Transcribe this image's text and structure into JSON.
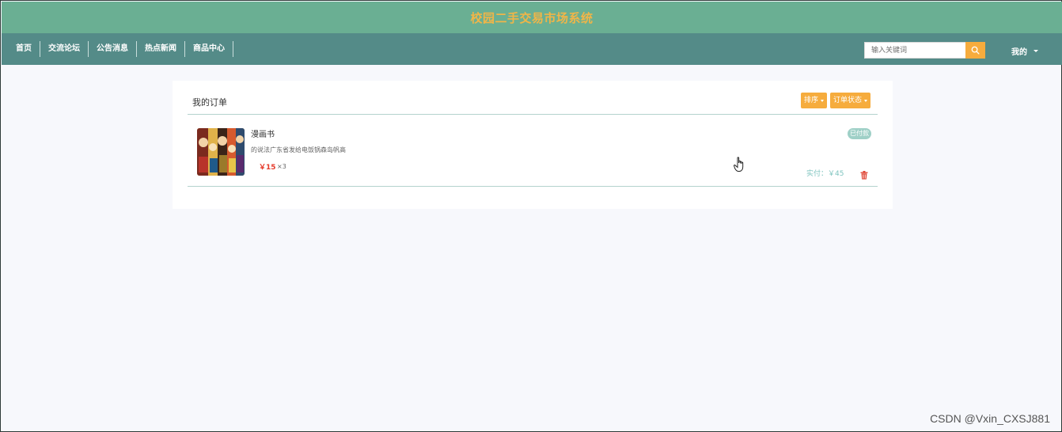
{
  "header": {
    "site_title": "校园二手交易市场系统"
  },
  "nav": {
    "items": [
      "首页",
      "交流论坛",
      "公告消息",
      "热点新闻",
      "商品中心"
    ],
    "search_placeholder": "输入关键词",
    "user_menu": "我的"
  },
  "orders": {
    "title": "我的订单",
    "sort_button": "排序",
    "status_button": "订单状态",
    "items": [
      {
        "name": "漫画书",
        "description": "的说法广东省发给电饭锅森岛帆高",
        "price": "￥15",
        "quantity": "×3",
        "status": "已付款",
        "paid": "实付：￥45"
      }
    ]
  },
  "icons": {
    "search": "search-icon",
    "delete": "trash-icon",
    "cursor": "hand-pointer-icon"
  },
  "colors": {
    "title_bar": "#6aaf93",
    "nav_bar": "#548b88",
    "accent": "#f6ac3d",
    "price": "#e53b2c",
    "status": "#9fd0c7"
  },
  "watermark": "CSDN @Vxin_CXSJ881"
}
